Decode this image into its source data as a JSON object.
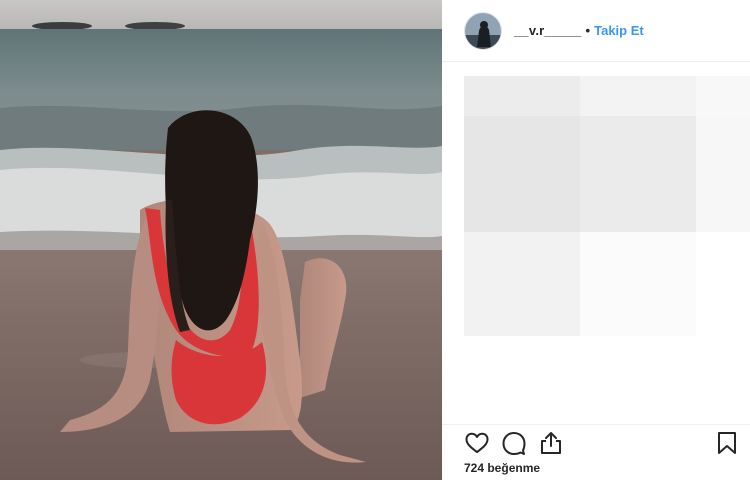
{
  "post": {
    "author": {
      "username": "__v.r_____",
      "separator": "•",
      "follow_label": "Takip Et"
    },
    "likes_text": "724 beğenme",
    "icons": {
      "like": "heart-icon",
      "comment": "comment-icon",
      "share": "share-icon",
      "save": "bookmark-icon"
    },
    "colors": {
      "link": "#3897f0",
      "text": "#262626",
      "swimsuit": "#d9363a",
      "sand": "#7a6660",
      "sea": "#6e7f82"
    }
  }
}
